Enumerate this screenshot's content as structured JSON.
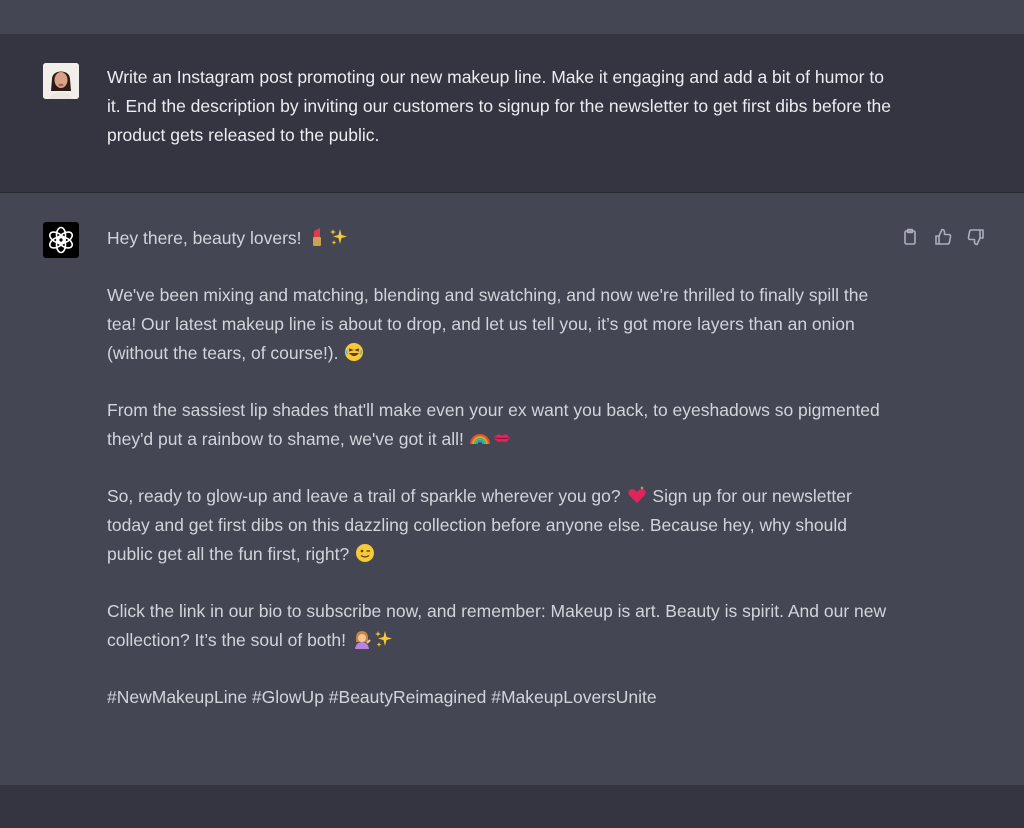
{
  "conversation": {
    "user_message": "Write an Instagram post promoting our new makeup line. Make it engaging and add a bit of humor to it. End the description by inviting our customers to signup for the newsletter to get first dibs before the product gets released to the public.",
    "assistant_paragraphs": {
      "p1": "Hey there, beauty lovers!",
      "p2": "We've been mixing and matching, blending and swatching, and now we're thrilled to finally spill the tea! Our latest makeup line is about to drop, and let us tell you, it’s got more layers than an onion (without the tears, of course!).",
      "p3": "From the sassiest lip shades that'll make even your ex want you back, to eyeshadows so pigmented they'd put a rainbow to shame, we've got it all!",
      "p4a": "So, ready to glow-up and leave a trail of sparkle wherever you go?",
      "p4b": "Sign up for our newsletter today and get first dibs on this dazzling collection before anyone else. Because hey, why should public get all the fun first, right?",
      "p5": "Click the link in our bio to subscribe now, and remember: Makeup is art. Beauty is spirit. And our new collection? It’s the soul of both!",
      "p6": "#NewMakeupLine #GlowUp #BeautyReimagined #MakeupLoversUnite"
    }
  },
  "icons": {
    "user_avatar": "user-avatar",
    "bot_avatar": "openai-logo-icon",
    "copy": "clipboard-icon",
    "thumbs_up": "thumbs-up-icon",
    "thumbs_down": "thumbs-down-icon"
  },
  "colors": {
    "page_bg": "#343541",
    "assistant_bg": "#444654",
    "text": "#d1d5db"
  }
}
